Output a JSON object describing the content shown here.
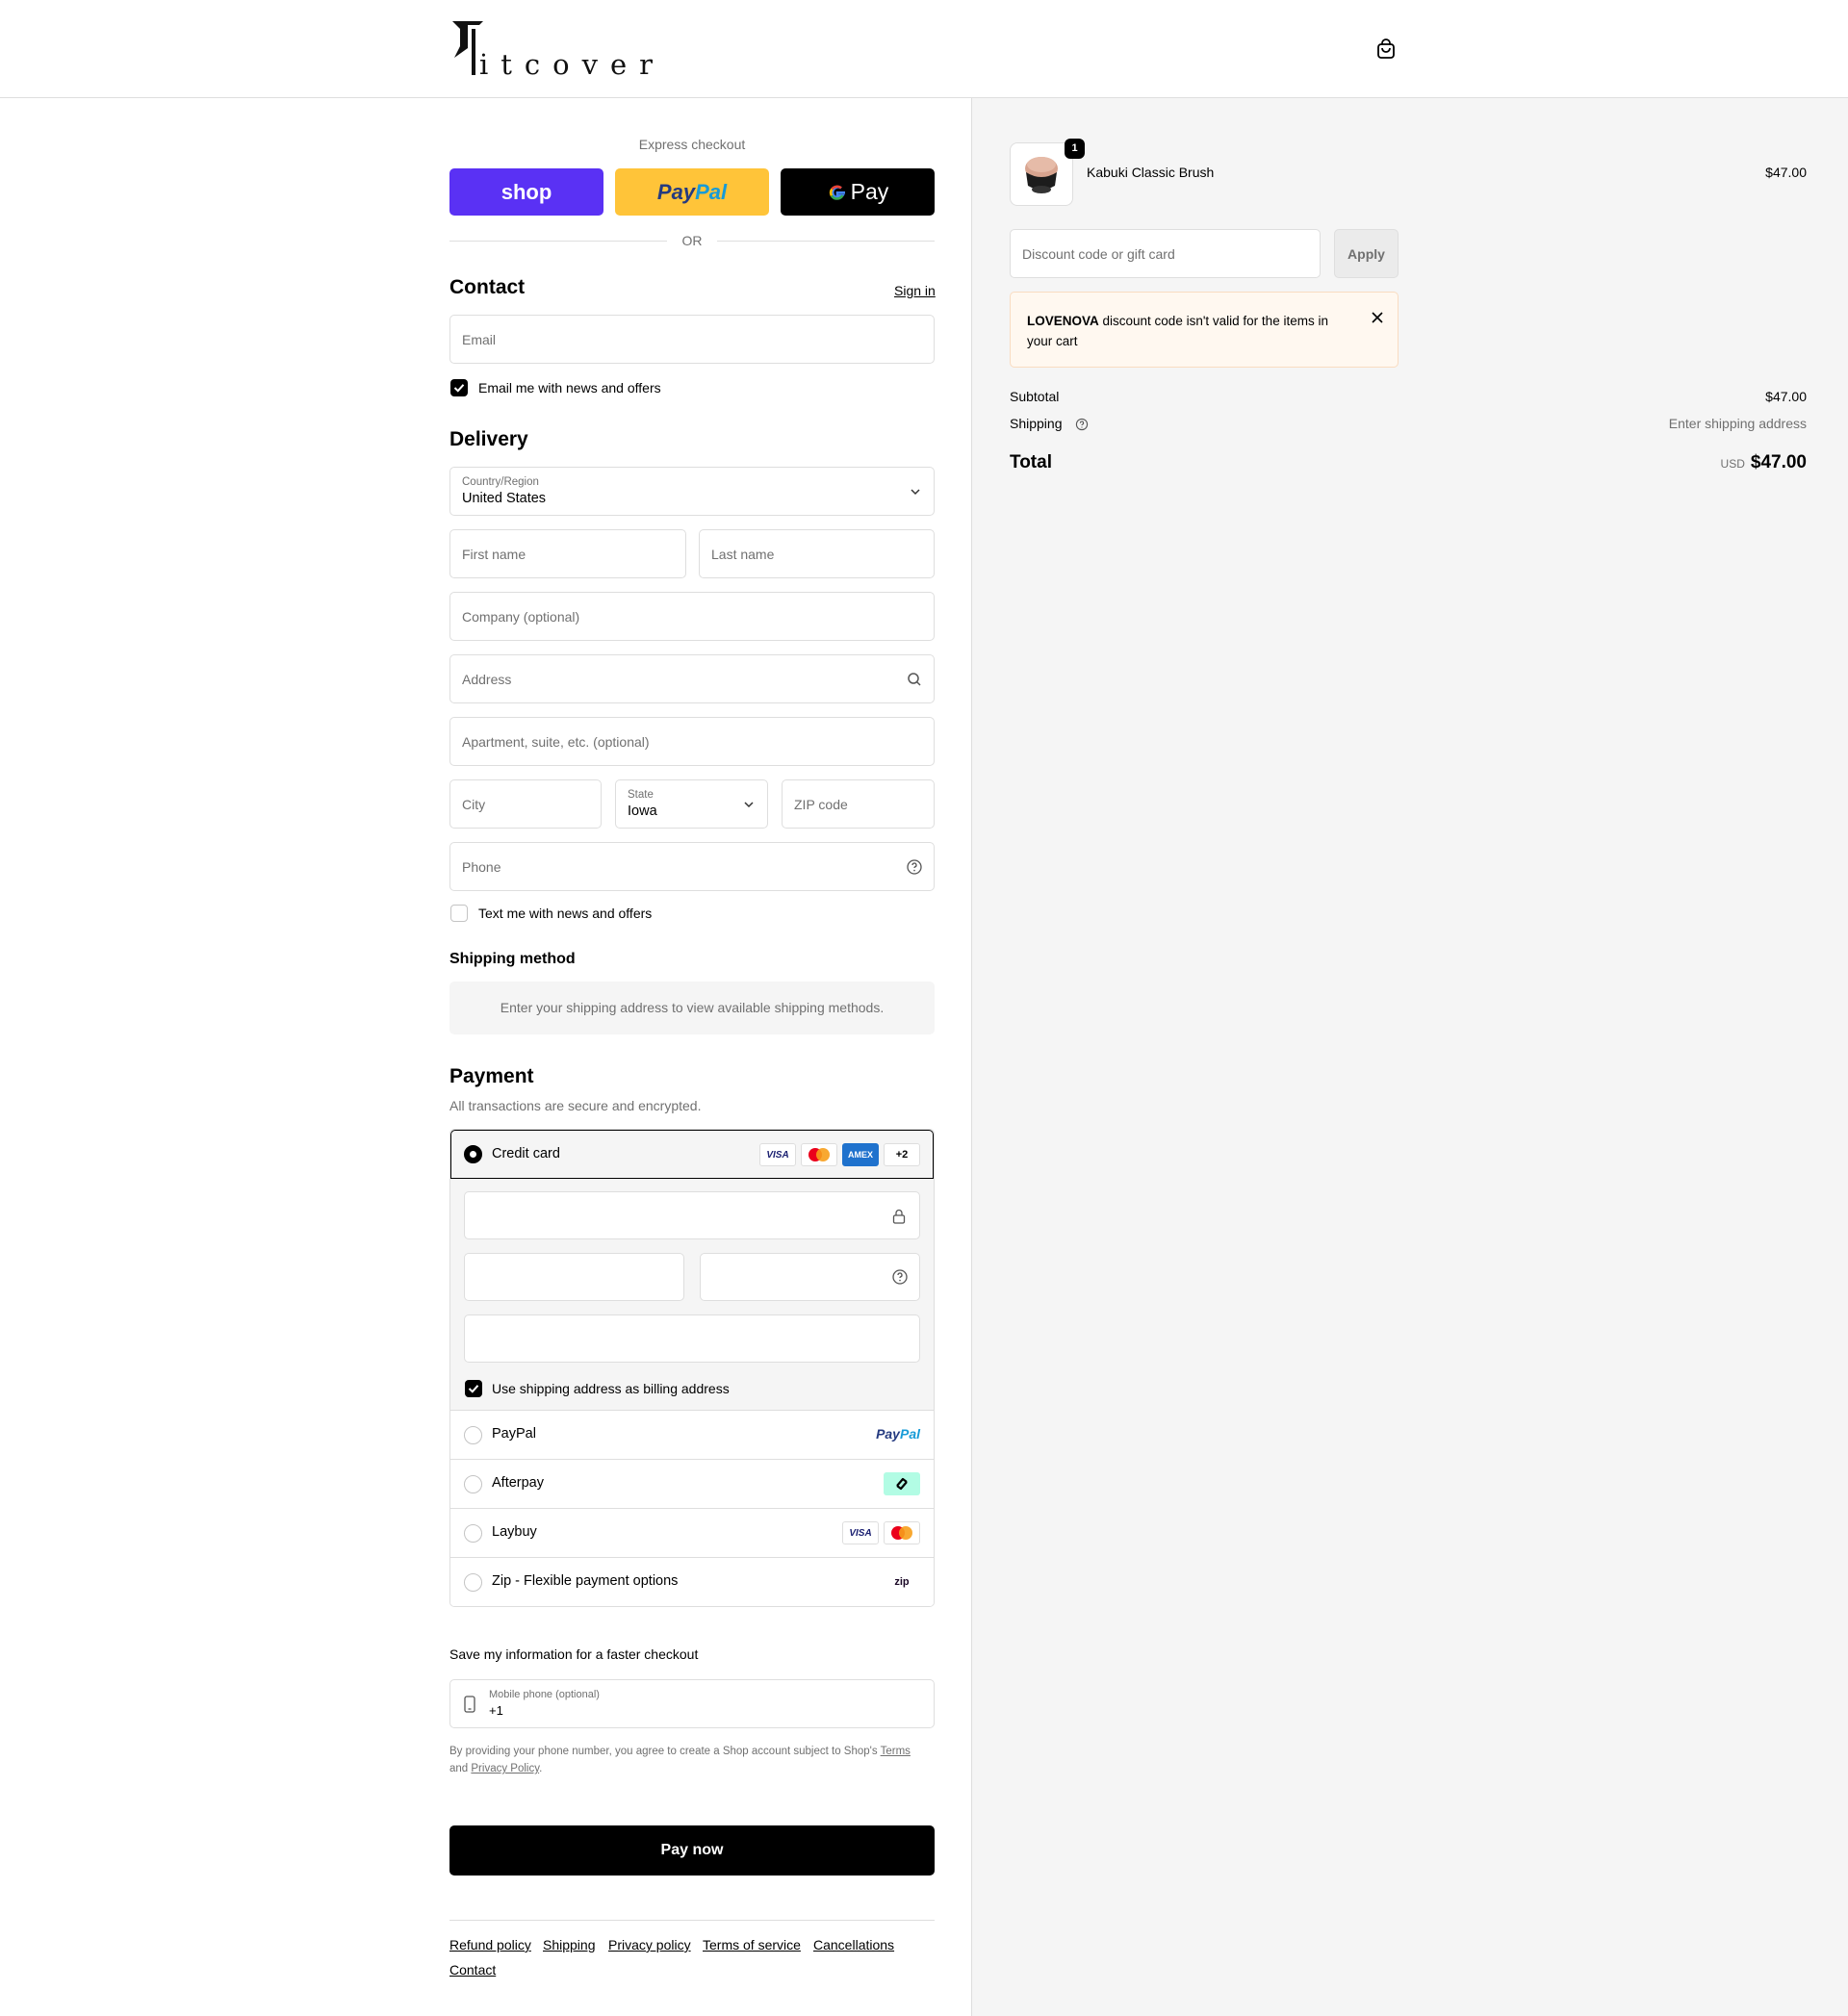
{
  "header": {
    "logo_text": "itcover",
    "cart_icon": "shopping-bag-icon"
  },
  "express": {
    "heading": "Express checkout",
    "shop_label": "shop",
    "paypal_label_1": "Pay",
    "paypal_label_2": "Pal",
    "gpay_label": "Pay",
    "or": "OR"
  },
  "contact": {
    "title": "Contact",
    "sign_in": "Sign in",
    "email_placeholder": "Email",
    "newsletter_label": "Email me with news and offers"
  },
  "delivery": {
    "title": "Delivery",
    "country_label": "Country/Region",
    "country_value": "United States",
    "first_name": "First name",
    "last_name": "Last name",
    "company": "Company (optional)",
    "address": "Address",
    "apartment": "Apartment, suite, etc. (optional)",
    "city": "City",
    "state_label": "State",
    "state_value": "Iowa",
    "zip": "ZIP code",
    "phone": "Phone",
    "sms_label": "Text me with news and offers"
  },
  "shipping_method": {
    "title": "Shipping method",
    "notice": "Enter your shipping address to view available shipping methods."
  },
  "payment": {
    "title": "Payment",
    "subtitle": "All transactions are secure and encrypted.",
    "credit_card": "Credit card",
    "more_cards": "+2",
    "visa": "VISA",
    "amex": "AMEX",
    "billing_label": "Use shipping address as billing address",
    "methods": [
      {
        "label": "PayPal"
      },
      {
        "label": "Afterpay"
      },
      {
        "label": "Laybuy"
      },
      {
        "label": "Zip - Flexible payment options"
      }
    ],
    "paypal_logo_1": "Pay",
    "paypal_logo_2": "Pal",
    "zip_logo": "zip"
  },
  "save_info": {
    "title": "Save my information for a faster checkout",
    "mobile_label": "Mobile phone (optional)",
    "mobile_value": "+1",
    "disclaimer_1": "By providing your phone number, you agree to create a Shop account subject to Shop's",
    "terms": "Terms",
    "and": "and",
    "privacy": "Privacy Policy",
    "period": "."
  },
  "pay_button": "Pay now",
  "footer": {
    "links": [
      "Refund policy",
      "Shipping",
      "Privacy policy",
      "Terms of service",
      "Cancellations",
      "Contact"
    ]
  },
  "summary": {
    "item_name": "Kabuki Classic Brush",
    "item_price": "$47.00",
    "item_qty": "1",
    "discount_placeholder": "Discount code or gift card",
    "apply": "Apply",
    "error_code": "LOVENOVA",
    "error_text": " discount code isn't valid for the items in your cart",
    "subtotal_label": "Subtotal",
    "subtotal_value": "$47.00",
    "shipping_label": "Shipping",
    "shipping_value": "Enter shipping address",
    "total_label": "Total",
    "currency": "USD",
    "total_value": "$47.00"
  },
  "colors": {
    "shop_purple": "#5a31f4",
    "paypal_yellow": "#ffc439",
    "error_bg": "#fff8f0"
  }
}
